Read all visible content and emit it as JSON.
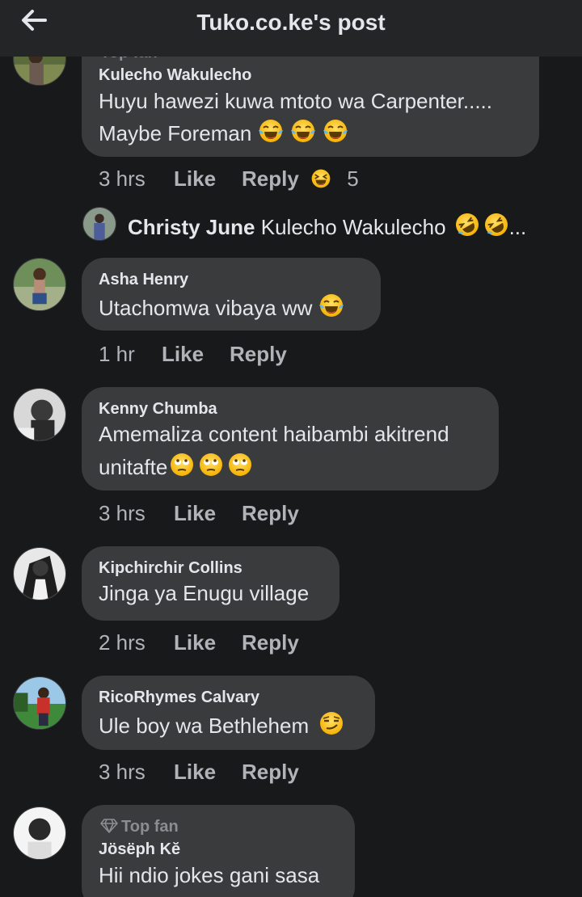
{
  "header": {
    "title": "Tuko.co.ke's post",
    "back_icon": "arrow-left-icon"
  },
  "comments": [
    {
      "name": "Kulecho Wakulecho",
      "badge": "Top fan",
      "lines": [
        "Huyu hawezi kuwa mtoto wa Carpenter.....",
        "Maybe Foreman"
      ],
      "emoji": [
        "tears-of-joy",
        "tears-of-joy",
        "tears-of-joy"
      ],
      "time": "3 hrs",
      "like": "Like",
      "reply": "Reply",
      "reaction": "laughing",
      "reaction_count": "5",
      "reply_preview": {
        "name": "Christy June",
        "text": "Kulecho Wakulecho",
        "emoji": [
          "rolling-laughing",
          "rolling-laughing"
        ],
        "ellipsis": "..."
      }
    },
    {
      "name": "Asha Henry",
      "lines": [
        "Utachomwa vibaya ww"
      ],
      "emoji": [
        "tears-of-joy"
      ],
      "time": "1 hr",
      "like": "Like",
      "reply": "Reply"
    },
    {
      "name": "Kenny Chumba",
      "lines": [
        "Amemaliza content haibambi akitrend",
        "unitafte"
      ],
      "emoji": [
        "rolling-eyes",
        "rolling-eyes",
        "rolling-eyes"
      ],
      "time": "3 hrs",
      "like": "Like",
      "reply": "Reply"
    },
    {
      "name": "Kipchirchir Collins",
      "lines": [
        "Jinga ya Enugu village"
      ],
      "time": "2 hrs",
      "like": "Like",
      "reply": "Reply"
    },
    {
      "name": "RicoRhymes Calvary",
      "lines": [
        "Ule boy wa Bethlehem"
      ],
      "emoji": [
        "smirk"
      ],
      "time": "3 hrs",
      "like": "Like",
      "reply": "Reply"
    },
    {
      "name": "Jösëph Kĕ",
      "badge": "Top fan",
      "lines": [
        "Hii ndio jokes gani sasa"
      ]
    }
  ],
  "colors": {
    "background": "#18191a",
    "bubble": "#3a3b3c",
    "header": "#242526",
    "text": "#e4e6eb",
    "muted": "#b0b3b8"
  }
}
